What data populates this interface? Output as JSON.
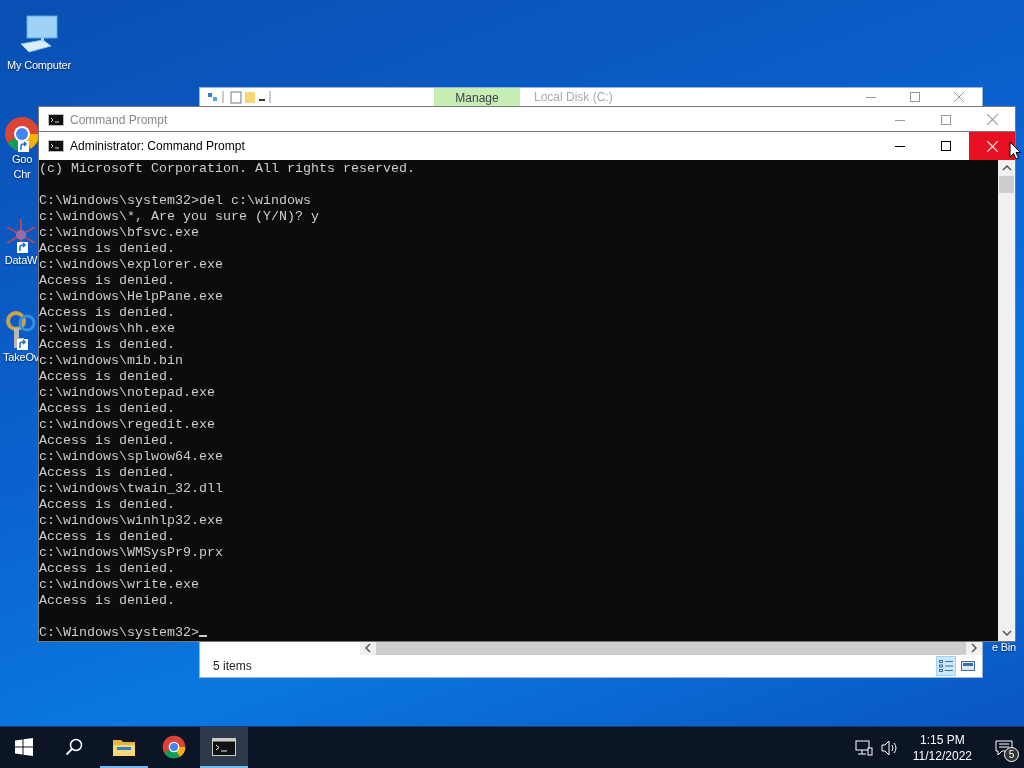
{
  "desktop_icons": [
    {
      "kind": "computer",
      "label_lines": [
        "My Computer"
      ],
      "shortcut": false
    },
    {
      "kind": "chrome",
      "label_lines": [
        "Goo",
        "Chr"
      ],
      "shortcut": true
    },
    {
      "kind": "datawindow",
      "label_lines": [
        "DataW"
      ],
      "shortcut": true
    },
    {
      "kind": "keys",
      "label_lines": [
        "TakeOv"
      ],
      "shortcut": true
    },
    {
      "kind": "recycle",
      "label_lines": [
        "e Bin"
      ],
      "shortcut": false
    }
  ],
  "explorer": {
    "contextual_tab": "Manage",
    "title": "Local Disk (C:)",
    "status": "5 items",
    "views": [
      {
        "kind": "details",
        "selected": true
      },
      {
        "kind": "tiles",
        "selected": false
      }
    ]
  },
  "back_window": {
    "title": "Command Prompt",
    "active": false
  },
  "window": {
    "title": "Administrator: Command Prompt",
    "active": true,
    "close_hovered": true
  },
  "console": {
    "cursor_visible": true,
    "blocks": [
      [
        "(c) Microsoft Corporation. All rights reserved."
      ],
      [
        "C:\\Windows\\system32>del c:\\windows",
        "c:\\windows\\*, Are you sure (Y/N)? y",
        "c:\\windows\\bfsvc.exe",
        "Access is denied.",
        "c:\\windows\\explorer.exe",
        "Access is denied.",
        "c:\\windows\\HelpPane.exe",
        "Access is denied.",
        "c:\\windows\\hh.exe",
        "Access is denied.",
        "c:\\windows\\mib.bin",
        "Access is denied.",
        "c:\\windows\\notepad.exe",
        "Access is denied.",
        "c:\\windows\\regedit.exe",
        "Access is denied.",
        "c:\\windows\\splwow64.exe",
        "Access is denied.",
        "c:\\windows\\twain_32.dll",
        "Access is denied.",
        "c:\\windows\\winhlp32.exe",
        "Access is denied.",
        "c:\\windows\\WMSysPr9.prx",
        "Access is denied.",
        "c:\\windows\\write.exe",
        "Access is denied."
      ],
      [
        "C:\\Windows\\system32>"
      ]
    ]
  },
  "taskbar": {
    "items": [
      {
        "kind": "start",
        "running": false,
        "active": false
      },
      {
        "kind": "search",
        "running": false,
        "active": false
      },
      {
        "kind": "explorer",
        "running": true,
        "active": false
      },
      {
        "kind": "chrome",
        "running": false,
        "active": false
      },
      {
        "kind": "cmd",
        "running": true,
        "active": true
      }
    ],
    "time": "1:15 PM",
    "date": "11/12/2022",
    "notifications": "5"
  }
}
